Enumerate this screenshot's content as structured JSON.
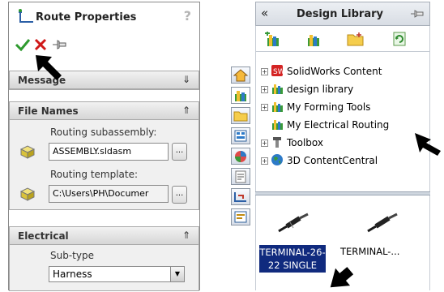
{
  "route_properties": {
    "title": "Route Properties",
    "help_label": "?",
    "message_section": {
      "label": "Message"
    },
    "file_names": {
      "label": "File Names",
      "routing_subassembly_label": "Routing subassembly:",
      "routing_subassembly_value": "ASSEMBLY.sldasm",
      "routing_template_label": "Routing template:",
      "routing_template_value": "C:\\Users\\PH\\Documer",
      "browse_label": "..."
    },
    "electrical": {
      "label": "Electrical",
      "subtype_label": "Sub-type",
      "subtype_value": "Harness"
    }
  },
  "design_library": {
    "title": "Design Library",
    "back_label": "«",
    "tree": [
      {
        "label": "SolidWorks Content",
        "expandable": true
      },
      {
        "label": "design library",
        "expandable": true
      },
      {
        "label": "My Forming Tools",
        "expandable": true
      },
      {
        "label": "My Electrical Routing",
        "expandable": false
      },
      {
        "label": "Toolbox",
        "expandable": true
      },
      {
        "label": "3D ContentCentral",
        "expandable": true
      }
    ],
    "gallery": [
      {
        "label": "TERMINAL-26-22 SINGLE",
        "line1": "TERMINAL-26-",
        "line2": "22 SINGLE",
        "selected": true
      },
      {
        "label": "TERMINAL-...",
        "line1": "TERMINAL-...",
        "line2": "",
        "selected": false
      }
    ]
  },
  "colors": {
    "selection": "#102a7e",
    "ok_green": "#2e9a2e",
    "cancel_red": "#d01818"
  }
}
